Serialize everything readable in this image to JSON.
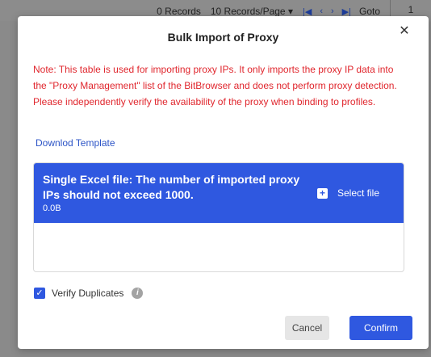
{
  "background": {
    "records_count": "0 Records",
    "records_per_page": "10 Records/Page",
    "dropdown_caret": "▾",
    "first_icon": "|◀",
    "prev_icon": "‹",
    "next_icon": "›",
    "last_icon": "▶|",
    "goto_label": "Goto",
    "page_value": "1"
  },
  "dialog": {
    "title": "Bulk Import of Proxy",
    "close_symbol": "✕",
    "note": "Note: This table is used for importing proxy IPs. It only imports the proxy IP data into the \"Proxy Management\" list of the BitBrowser and does not perform proxy detection. Please independently verify the availability of the proxy when binding to profiles.",
    "template_link": "Downlod Template",
    "upload": {
      "title": "Single Excel file: The number of imported proxy IPs should not exceed 1000.",
      "size": "0.0B",
      "plus_symbol": "+",
      "select_label": "Select file"
    },
    "verify": {
      "checked": true,
      "check_symbol": "✓",
      "label": "Verify Duplicates",
      "info_symbol": "i"
    },
    "buttons": {
      "cancel": "Cancel",
      "confirm": "Confirm"
    }
  },
  "colors": {
    "accent": "#2f58e0",
    "note_red": "#e0262d",
    "overlay": "#8a8a8a"
  }
}
